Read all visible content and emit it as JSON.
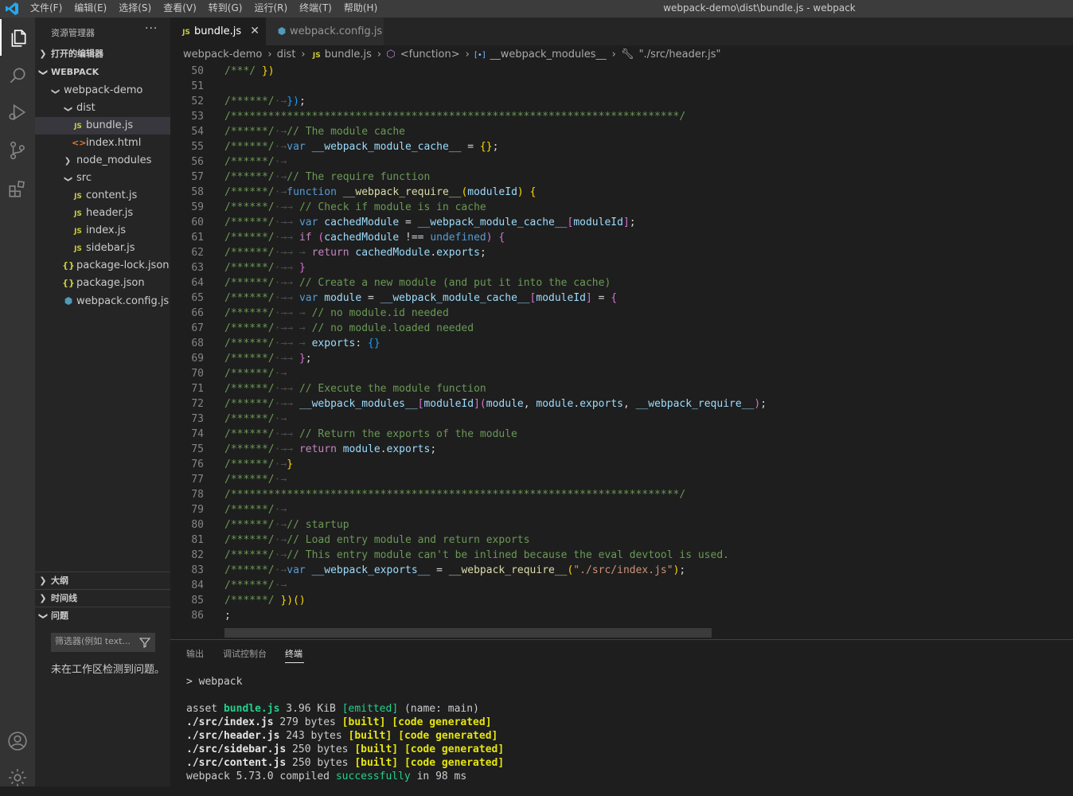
{
  "menu": [
    "文件(F)",
    "编辑(E)",
    "选择(S)",
    "查看(V)",
    "转到(G)",
    "运行(R)",
    "终端(T)",
    "帮助(H)"
  ],
  "window_title": "webpack-demo\\dist\\bundle.js - webpack",
  "sidebar": {
    "title": "资源管理器",
    "more": "···",
    "open_editors": "打开的编辑器",
    "workspace": "WEBPACK",
    "tree": [
      {
        "label": "webpack-demo",
        "type": "folder",
        "open": true,
        "depth": 1
      },
      {
        "label": "dist",
        "type": "folder",
        "open": true,
        "depth": 2
      },
      {
        "label": "bundle.js",
        "type": "js",
        "depth": 3,
        "selected": true
      },
      {
        "label": "index.html",
        "type": "html",
        "depth": 3
      },
      {
        "label": "node_modules",
        "type": "folder",
        "open": false,
        "depth": 2
      },
      {
        "label": "src",
        "type": "folder",
        "open": true,
        "depth": 2
      },
      {
        "label": "content.js",
        "type": "js",
        "depth": 3
      },
      {
        "label": "header.js",
        "type": "js",
        "depth": 3
      },
      {
        "label": "index.js",
        "type": "js",
        "depth": 3
      },
      {
        "label": "sidebar.js",
        "type": "js",
        "depth": 3
      },
      {
        "label": "package-lock.json",
        "type": "json",
        "depth": 2
      },
      {
        "label": "package.json",
        "type": "json",
        "depth": 2
      },
      {
        "label": "webpack.config.js",
        "type": "webpack",
        "depth": 2
      }
    ],
    "outline": "大纲",
    "timeline": "时间线",
    "problems": "问题",
    "filter_placeholder": "筛选器(例如 text...",
    "no_problems": "未在工作区检测到问题。"
  },
  "tabs": [
    {
      "label": "bundle.js",
      "icon": "JS",
      "active": true
    },
    {
      "label": "webpack.config.js",
      "icon": "webpack-icon",
      "active": false
    }
  ],
  "breadcrumb": [
    "webpack-demo",
    "dist",
    "bundle.js",
    "<function>",
    "__webpack_modules__",
    "\"./src/header.js\""
  ],
  "breadcrumb_icons": {
    "bundle": "JS",
    "function": "cube-icon",
    "modules": "variable-icon",
    "header": "wrench-icon"
  },
  "code_lines": [
    {
      "n": "50",
      "t": [
        [
          "cm",
          "/***/ "
        ],
        [
          "b1",
          "})"
        ]
      ]
    },
    {
      "n": "51",
      "t": []
    },
    {
      "n": "52",
      "t": [
        [
          "cm",
          "/******/"
        ],
        [
          "ws",
          "·→"
        ],
        [
          "b3",
          "})"
        ],
        [
          "p",
          ";"
        ]
      ]
    },
    {
      "n": "53",
      "t": [
        [
          "cm",
          "/************************************************************************/"
        ]
      ]
    },
    {
      "n": "54",
      "t": [
        [
          "cm",
          "/******/"
        ],
        [
          "ws",
          "·→"
        ],
        [
          "cm",
          "// The module cache"
        ]
      ]
    },
    {
      "n": "55",
      "t": [
        [
          "cm",
          "/******/"
        ],
        [
          "ws",
          "·→"
        ],
        [
          "kw",
          "var "
        ],
        [
          "var",
          "__webpack_module_cache__"
        ],
        [
          "p",
          " = "
        ],
        [
          "b1",
          "{}"
        ],
        [
          "p",
          ";"
        ]
      ]
    },
    {
      "n": "56",
      "t": [
        [
          "cm",
          "/******/"
        ],
        [
          "ws",
          "·→"
        ]
      ]
    },
    {
      "n": "57",
      "t": [
        [
          "cm",
          "/******/"
        ],
        [
          "ws",
          "·→"
        ],
        [
          "cm",
          "// The require function"
        ]
      ]
    },
    {
      "n": "58",
      "t": [
        [
          "cm",
          "/******/"
        ],
        [
          "ws",
          "·→"
        ],
        [
          "kw",
          "function "
        ],
        [
          "fn",
          "__webpack_require__"
        ],
        [
          "b1",
          "("
        ],
        [
          "var",
          "moduleId"
        ],
        [
          "b1",
          ")"
        ],
        [
          "p",
          " "
        ],
        [
          "b1",
          "{"
        ]
      ]
    },
    {
      "n": "59",
      "t": [
        [
          "cm",
          "/******/"
        ],
        [
          "ws",
          "·→→ "
        ],
        [
          "cm",
          "// Check if module is in cache"
        ]
      ]
    },
    {
      "n": "60",
      "t": [
        [
          "cm",
          "/******/"
        ],
        [
          "ws",
          "·→→ "
        ],
        [
          "kw",
          "var "
        ],
        [
          "var",
          "cachedModule"
        ],
        [
          "p",
          " = "
        ],
        [
          "var",
          "__webpack_module_cache__"
        ],
        [
          "b2",
          "["
        ],
        [
          "var",
          "moduleId"
        ],
        [
          "b2",
          "]"
        ],
        [
          "p",
          ";"
        ]
      ]
    },
    {
      "n": "61",
      "t": [
        [
          "cm",
          "/******/"
        ],
        [
          "ws",
          "·→→ "
        ],
        [
          "ctl",
          "if "
        ],
        [
          "b2",
          "("
        ],
        [
          "var",
          "cachedModule"
        ],
        [
          "p",
          " !== "
        ],
        [
          "kw",
          "undefined"
        ],
        [
          "b2",
          ")"
        ],
        [
          "p",
          " "
        ],
        [
          "b2",
          "{"
        ]
      ]
    },
    {
      "n": "62",
      "t": [
        [
          "cm",
          "/******/"
        ],
        [
          "ws",
          "·→→ → "
        ],
        [
          "ctl",
          "return "
        ],
        [
          "var",
          "cachedModule"
        ],
        [
          "p",
          "."
        ],
        [
          "var",
          "exports"
        ],
        [
          "p",
          ";"
        ]
      ]
    },
    {
      "n": "63",
      "t": [
        [
          "cm",
          "/******/"
        ],
        [
          "ws",
          "·→→ "
        ],
        [
          "b2",
          "}"
        ]
      ]
    },
    {
      "n": "64",
      "t": [
        [
          "cm",
          "/******/"
        ],
        [
          "ws",
          "·→→ "
        ],
        [
          "cm",
          "// Create a new module (and put it into the cache)"
        ]
      ]
    },
    {
      "n": "65",
      "t": [
        [
          "cm",
          "/******/"
        ],
        [
          "ws",
          "·→→ "
        ],
        [
          "kw",
          "var "
        ],
        [
          "var",
          "module"
        ],
        [
          "p",
          " = "
        ],
        [
          "var",
          "__webpack_module_cache__"
        ],
        [
          "b2",
          "["
        ],
        [
          "var",
          "moduleId"
        ],
        [
          "b2",
          "]"
        ],
        [
          "p",
          " = "
        ],
        [
          "b2",
          "{"
        ]
      ]
    },
    {
      "n": "66",
      "t": [
        [
          "cm",
          "/******/"
        ],
        [
          "ws",
          "·→→ → "
        ],
        [
          "cm",
          "// no module.id needed"
        ]
      ]
    },
    {
      "n": "67",
      "t": [
        [
          "cm",
          "/******/"
        ],
        [
          "ws",
          "·→→ → "
        ],
        [
          "cm",
          "// no module.loaded needed"
        ]
      ]
    },
    {
      "n": "68",
      "t": [
        [
          "cm",
          "/******/"
        ],
        [
          "ws",
          "·→→ → "
        ],
        [
          "var",
          "exports"
        ],
        [
          "p",
          ": "
        ],
        [
          "b3",
          "{}"
        ]
      ]
    },
    {
      "n": "69",
      "t": [
        [
          "cm",
          "/******/"
        ],
        [
          "ws",
          "·→→ "
        ],
        [
          "b2",
          "}"
        ],
        [
          "p",
          ";"
        ]
      ]
    },
    {
      "n": "70",
      "t": [
        [
          "cm",
          "/******/"
        ],
        [
          "ws",
          "·→"
        ]
      ]
    },
    {
      "n": "71",
      "t": [
        [
          "cm",
          "/******/"
        ],
        [
          "ws",
          "·→→ "
        ],
        [
          "cm",
          "// Execute the module function"
        ]
      ]
    },
    {
      "n": "72",
      "t": [
        [
          "cm",
          "/******/"
        ],
        [
          "ws",
          "·→→ "
        ],
        [
          "var",
          "__webpack_modules__"
        ],
        [
          "b2",
          "["
        ],
        [
          "var",
          "moduleId"
        ],
        [
          "b2",
          "]("
        ],
        [
          "var",
          "module"
        ],
        [
          "p",
          ", "
        ],
        [
          "var",
          "module"
        ],
        [
          "p",
          "."
        ],
        [
          "var",
          "exports"
        ],
        [
          "p",
          ", "
        ],
        [
          "var",
          "__webpack_require__"
        ],
        [
          "b2",
          ")"
        ],
        [
          "p",
          ";"
        ]
      ]
    },
    {
      "n": "73",
      "t": [
        [
          "cm",
          "/******/"
        ],
        [
          "ws",
          "·→"
        ]
      ]
    },
    {
      "n": "74",
      "t": [
        [
          "cm",
          "/******/"
        ],
        [
          "ws",
          "·→→ "
        ],
        [
          "cm",
          "// Return the exports of the module"
        ]
      ]
    },
    {
      "n": "75",
      "t": [
        [
          "cm",
          "/******/"
        ],
        [
          "ws",
          "·→→ "
        ],
        [
          "ctl",
          "return "
        ],
        [
          "var",
          "module"
        ],
        [
          "p",
          "."
        ],
        [
          "var",
          "exports"
        ],
        [
          "p",
          ";"
        ]
      ]
    },
    {
      "n": "76",
      "t": [
        [
          "cm",
          "/******/"
        ],
        [
          "ws",
          "·→"
        ],
        [
          "b1",
          "}"
        ]
      ]
    },
    {
      "n": "77",
      "t": [
        [
          "cm",
          "/******/"
        ],
        [
          "ws",
          "·→"
        ]
      ]
    },
    {
      "n": "78",
      "t": [
        [
          "cm",
          "/************************************************************************/"
        ]
      ]
    },
    {
      "n": "79",
      "t": [
        [
          "cm",
          "/******/"
        ],
        [
          "ws",
          "·→"
        ]
      ]
    },
    {
      "n": "80",
      "t": [
        [
          "cm",
          "/******/"
        ],
        [
          "ws",
          "·→"
        ],
        [
          "cm",
          "// startup"
        ]
      ]
    },
    {
      "n": "81",
      "t": [
        [
          "cm",
          "/******/"
        ],
        [
          "ws",
          "·→"
        ],
        [
          "cm",
          "// Load entry module and return exports"
        ]
      ]
    },
    {
      "n": "82",
      "t": [
        [
          "cm",
          "/******/"
        ],
        [
          "ws",
          "·→"
        ],
        [
          "cm",
          "// This entry module can't be inlined because the eval devtool is used."
        ]
      ]
    },
    {
      "n": "83",
      "t": [
        [
          "cm",
          "/******/"
        ],
        [
          "ws",
          "·→"
        ],
        [
          "kw",
          "var "
        ],
        [
          "var",
          "__webpack_exports__"
        ],
        [
          "p",
          " = "
        ],
        [
          "fn",
          "__webpack_require__"
        ],
        [
          "b1",
          "("
        ],
        [
          "str",
          "\"./src/index.js\""
        ],
        [
          "b1",
          ")"
        ],
        [
          "p",
          ";"
        ]
      ]
    },
    {
      "n": "84",
      "t": [
        [
          "cm",
          "/******/"
        ],
        [
          "ws",
          "·→"
        ]
      ]
    },
    {
      "n": "85",
      "t": [
        [
          "cm",
          "/******/ "
        ],
        [
          "b1",
          "})"
        ],
        [
          "b1",
          "()"
        ]
      ]
    },
    {
      "n": "86",
      "t": [
        [
          "p",
          ";"
        ]
      ]
    }
  ],
  "panel": {
    "tabs": [
      "输出",
      "调试控制台",
      "终端"
    ],
    "active_tab": "终端",
    "terminal": [
      [
        [
          "p",
          "> webpack"
        ]
      ],
      [],
      [
        [
          "p",
          "asset "
        ],
        [
          "g",
          "bundle.js"
        ],
        [
          "p",
          " 3.96 KiB "
        ],
        [
          "gn",
          "[emitted]"
        ],
        [
          "p",
          " (name: main)"
        ]
      ],
      [
        [
          "b",
          "./src/index.js"
        ],
        [
          "p",
          " 279 bytes "
        ],
        [
          "y",
          "[built]"
        ],
        [
          "p",
          " "
        ],
        [
          "y",
          "[code generated]"
        ]
      ],
      [
        [
          "b",
          "./src/header.js"
        ],
        [
          "p",
          " 243 bytes "
        ],
        [
          "y",
          "[built]"
        ],
        [
          "p",
          " "
        ],
        [
          "y",
          "[code generated]"
        ]
      ],
      [
        [
          "b",
          "./src/sidebar.js"
        ],
        [
          "p",
          " 250 bytes "
        ],
        [
          "y",
          "[built]"
        ],
        [
          "p",
          " "
        ],
        [
          "y",
          "[code generated]"
        ]
      ],
      [
        [
          "b",
          "./src/content.js"
        ],
        [
          "p",
          " 250 bytes "
        ],
        [
          "y",
          "[built]"
        ],
        [
          "p",
          " "
        ],
        [
          "y",
          "[code generated]"
        ]
      ],
      [
        [
          "p",
          "webpack 5.73.0 compiled "
        ],
        [
          "gn",
          "successfully"
        ],
        [
          "p",
          " in 98 ms"
        ]
      ]
    ]
  },
  "colors": {
    "activity_bar": "#333333",
    "sidebar": "#252526",
    "editor": "#1e1e1e",
    "titlebar": "#3c3c3c",
    "accent": "#007acc",
    "selection": "#37373d"
  }
}
